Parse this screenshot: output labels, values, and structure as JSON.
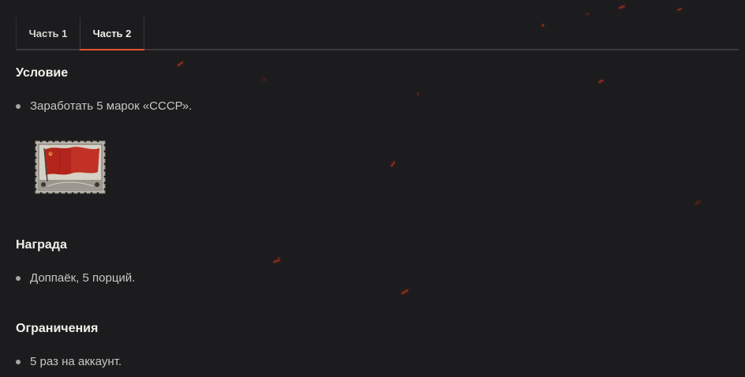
{
  "tabs": [
    {
      "label": "Часть 1",
      "active": false
    },
    {
      "label": "Часть 2",
      "active": true
    }
  ],
  "condition": {
    "title": "Условие",
    "items": [
      "Заработать 5 марок «СССР»."
    ],
    "stamp_icon": "ussr-flag-stamp-icon"
  },
  "reward": {
    "title": "Награда",
    "items": [
      "Доппаёк, 5 порций."
    ]
  },
  "limits": {
    "title": "Ограничения",
    "items": [
      "5 раз на аккаунт."
    ]
  },
  "colors": {
    "background": "#1c1c1e",
    "accent": "#e2552e",
    "text": "#c8c6c0",
    "heading": "#f2f0ea"
  }
}
